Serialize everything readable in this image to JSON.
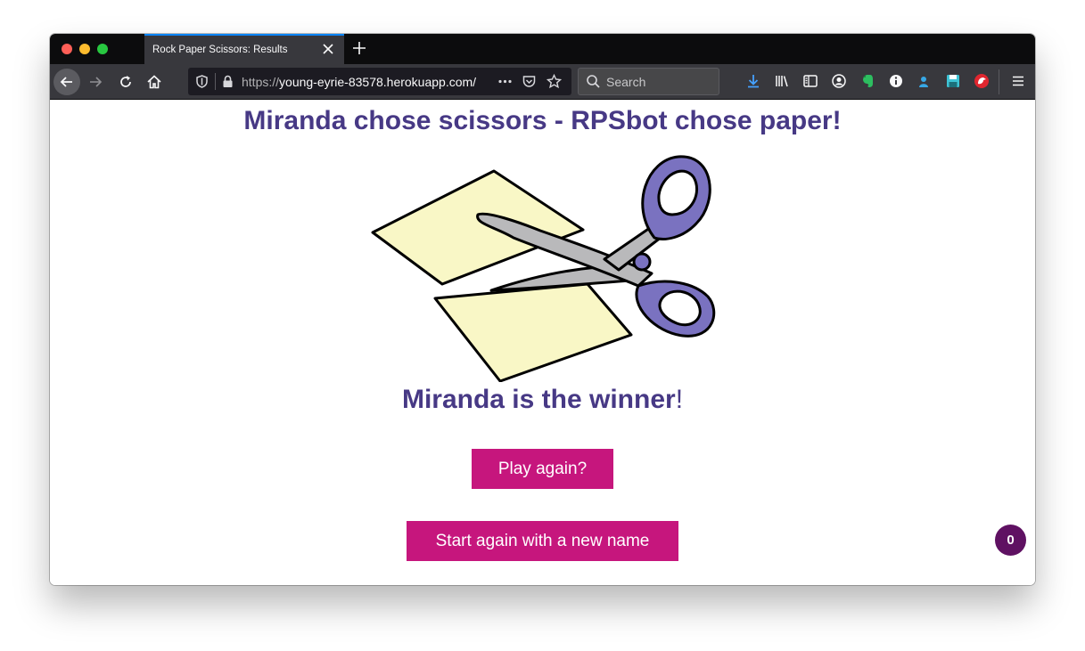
{
  "browser": {
    "tab_title": "Rock Paper Scissors: Results",
    "url_scheme": "https://",
    "url_host": "young-eyrie-83578.herokuapp.com/",
    "search_placeholder": "Search",
    "notification_badge": "0",
    "icons": [
      "back-arrow-icon",
      "forward-arrow-icon",
      "reload-icon",
      "home-icon",
      "tracking-shield-icon",
      "lock-icon",
      "page-actions-icon",
      "pocket-icon",
      "bookmark-star-icon",
      "search-icon",
      "download-icon",
      "library-icon",
      "sidebar-icon",
      "account-icon",
      "evernote-icon",
      "info-icon",
      "extension-icon",
      "save-icon",
      "bird-icon",
      "hamburger-menu-icon"
    ]
  },
  "page": {
    "headline": "Miranda chose scissors - RPSbot chose paper!",
    "winner_text": "Miranda is the winner",
    "winner_punct": "!",
    "play_again_label": "Play again?",
    "restart_label": "Start again with a new name",
    "counter_value": "0"
  },
  "colors": {
    "heading": "#473985",
    "button": "#c6167d",
    "counter": "#5f1162",
    "paper": "#f9f7c6",
    "scissor_handle": "#7a72c0",
    "scissor_blade": "#b9b9bb"
  }
}
